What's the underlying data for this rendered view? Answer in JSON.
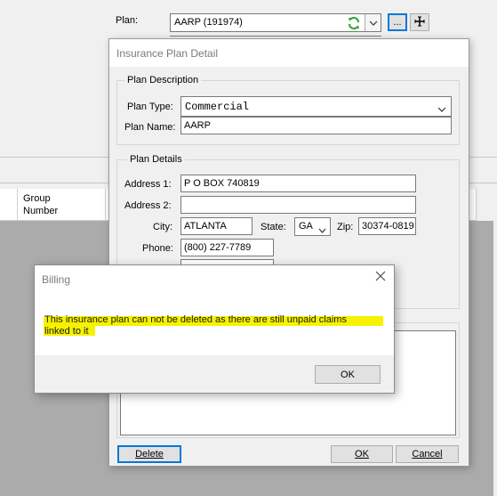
{
  "background": {
    "plan_label": "Plan:",
    "plan_value": "AARP (191974)",
    "refresh_icon": "refresh-icon",
    "ellipsis_label": "...",
    "add_icon": "plus-cross-icon",
    "grid_column_1": "Group",
    "grid_column_2": "Number"
  },
  "plan_dialog": {
    "title": "Insurance Plan Detail",
    "plan_description_group": "Plan Description",
    "plan_type_label": "Plan Type:",
    "plan_type_value": "Commercial",
    "plan_name_label": "Plan Name:",
    "plan_name_value": "AARP",
    "plan_details_group": "Plan Details",
    "address1_label": "Address 1:",
    "address1_value": "P O BOX 740819",
    "address2_label": "Address 2:",
    "address2_value": "",
    "city_label": "City:",
    "city_value": "ATLANTA",
    "state_label": "State:",
    "state_value": "GA",
    "zip_label": "Zip:",
    "zip_value": "30374-0819",
    "phone_label": "Phone:",
    "phone_value": "(800) 227-7789",
    "fax_label_partial": "F",
    "delete_button": "Delete",
    "ok_button": "OK",
    "cancel_button": "Cancel"
  },
  "message_box": {
    "title": "Billing",
    "close_icon": "close-x-icon",
    "message_line_1": "This insurance plan can not be deleted as there are still unpaid claims",
    "message_line_2": "linked to it",
    "ok_button": "OK",
    "highlight_color": "#f6f200"
  }
}
